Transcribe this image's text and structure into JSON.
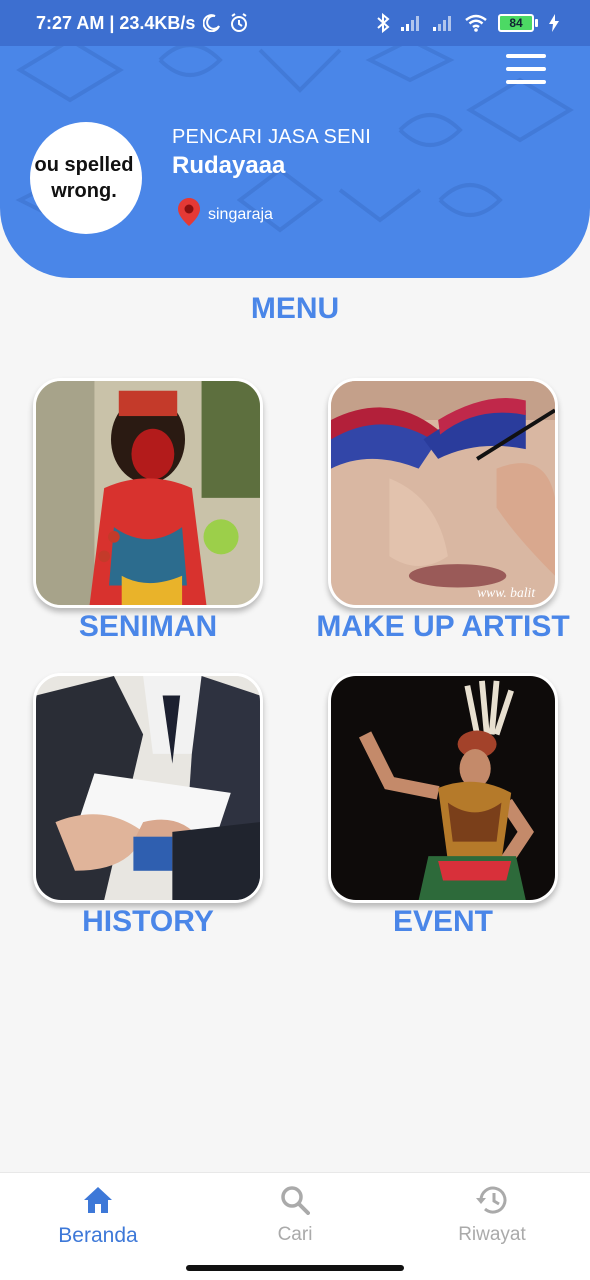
{
  "status_bar": {
    "time_speed": "7:27 AM | 23.4KB/s",
    "battery": "84",
    "icons": [
      "moon-icon",
      "alarm-icon",
      "bluetooth-icon",
      "signal-icon",
      "signal-icon",
      "wifi-icon",
      "battery-icon",
      "charging-icon"
    ]
  },
  "header": {
    "menu_icon": "hamburger-menu-icon",
    "avatar_text": "ou spelled\nwrong.",
    "role": "PENCARI JASA SENI",
    "name": "Rudayaaa",
    "location": "singaraja",
    "location_icon": "location-pin-icon",
    "colors": {
      "primary": "#4a86e8",
      "pin": "#e53935"
    }
  },
  "menu": {
    "title": "MENU",
    "items": [
      {
        "label": "SENIMAN"
      },
      {
        "label": "MAKE UP ARTIST"
      },
      {
        "label": "HISTORY"
      },
      {
        "label": "EVENT"
      }
    ]
  },
  "bottom_nav": {
    "items": [
      {
        "label": "Beranda",
        "icon": "home-icon",
        "active": true
      },
      {
        "label": "Cari",
        "icon": "search-icon",
        "active": false
      },
      {
        "label": "Riwayat",
        "icon": "history-icon",
        "active": false
      }
    ]
  }
}
